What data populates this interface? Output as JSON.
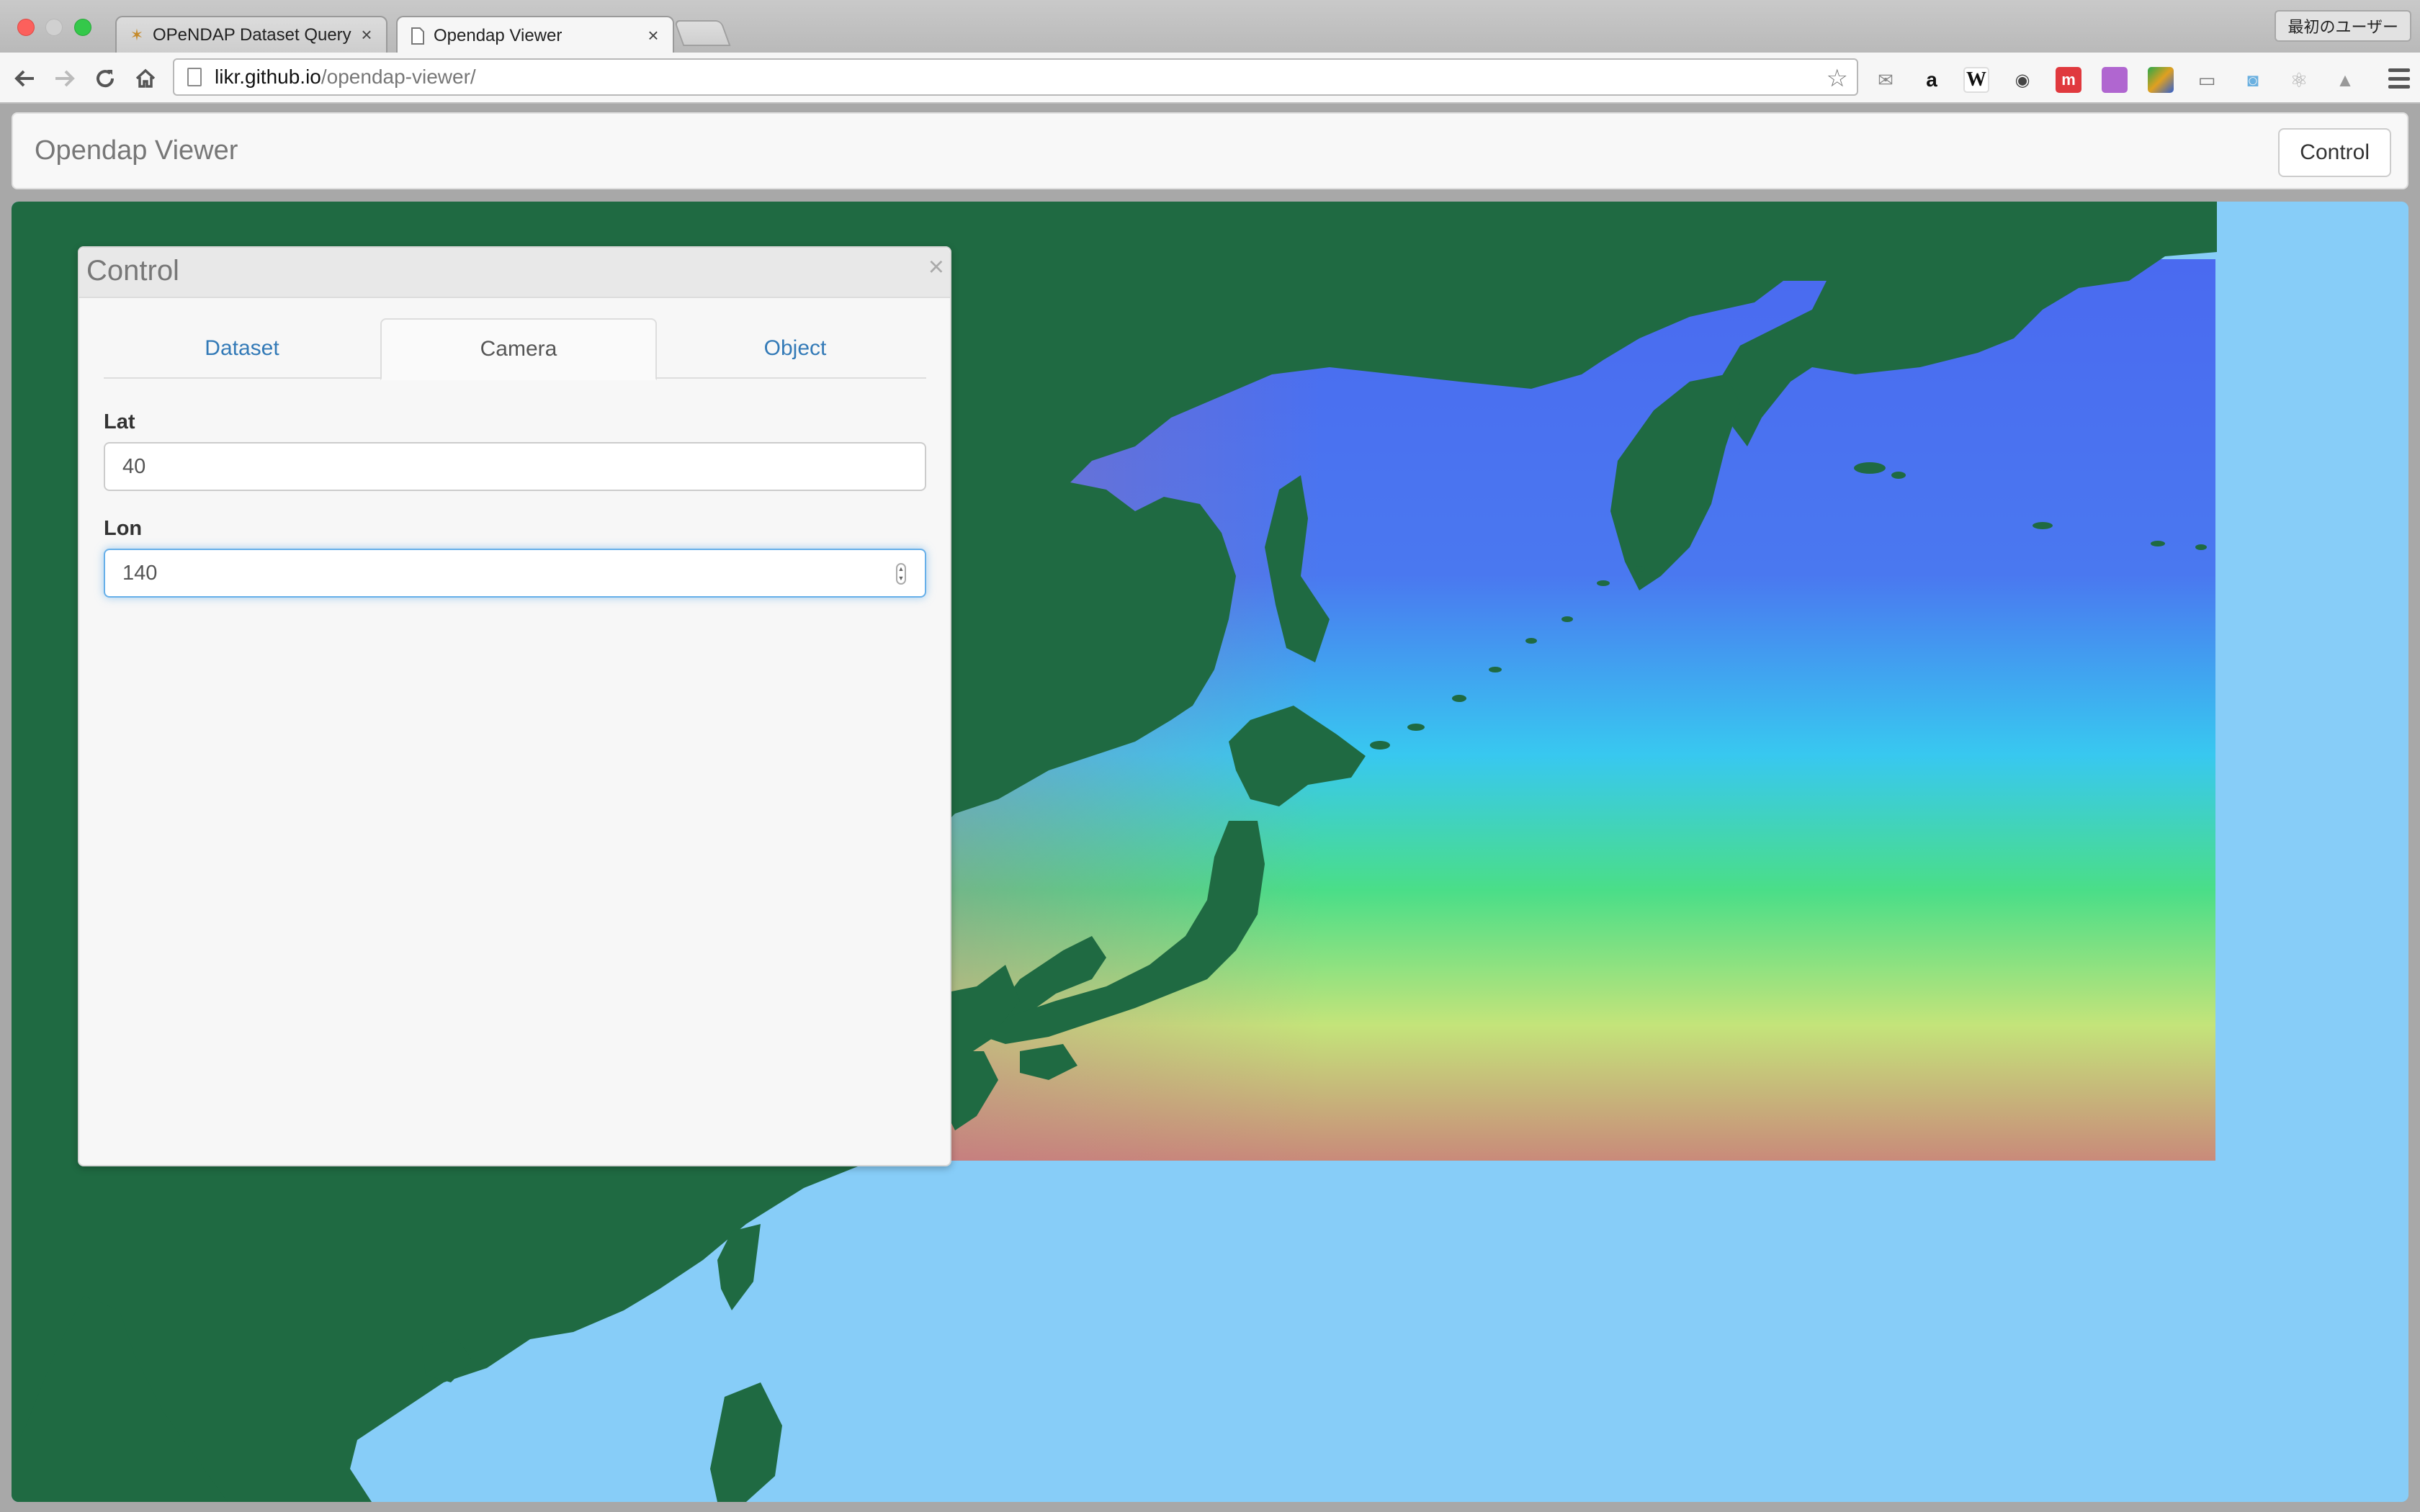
{
  "browser": {
    "tabs": [
      {
        "title": "OPeNDAP Dataset Query F",
        "icon": "opendap-favicon",
        "active": false
      },
      {
        "title": "Opendap Viewer",
        "icon": "page-icon",
        "active": true
      }
    ],
    "profile_name": "最初のユーザー",
    "url_host": "likr.github.io",
    "url_path": "/opendap-viewer/",
    "extensions": [
      "gmail-icon",
      "amazon-icon",
      "wikipedia-icon",
      "mask-icon",
      "meetup-icon",
      "purple-square-icon",
      "dev-tools-icon",
      "cast-icon",
      "camera-icon",
      "react-icon",
      "drive-icon"
    ]
  },
  "navbar": {
    "brand": "Opendap Viewer",
    "control_button": "Control"
  },
  "control_panel": {
    "title": "Control",
    "close_glyph": "×",
    "tabs": [
      {
        "label": "Dataset",
        "active": false
      },
      {
        "label": "Camera",
        "active": true
      },
      {
        "label": "Object",
        "active": false
      }
    ],
    "fields": {
      "lat": {
        "label": "Lat",
        "value": "40"
      },
      "lon": {
        "label": "Lon",
        "value": "140"
      }
    }
  },
  "map": {
    "ocean_color": "#87cdf8",
    "land_color": "#1f6a42",
    "colormap": [
      "#4a6af0",
      "#38c8f0",
      "#4ade88",
      "#c4e47a",
      "#c98a7a"
    ]
  }
}
